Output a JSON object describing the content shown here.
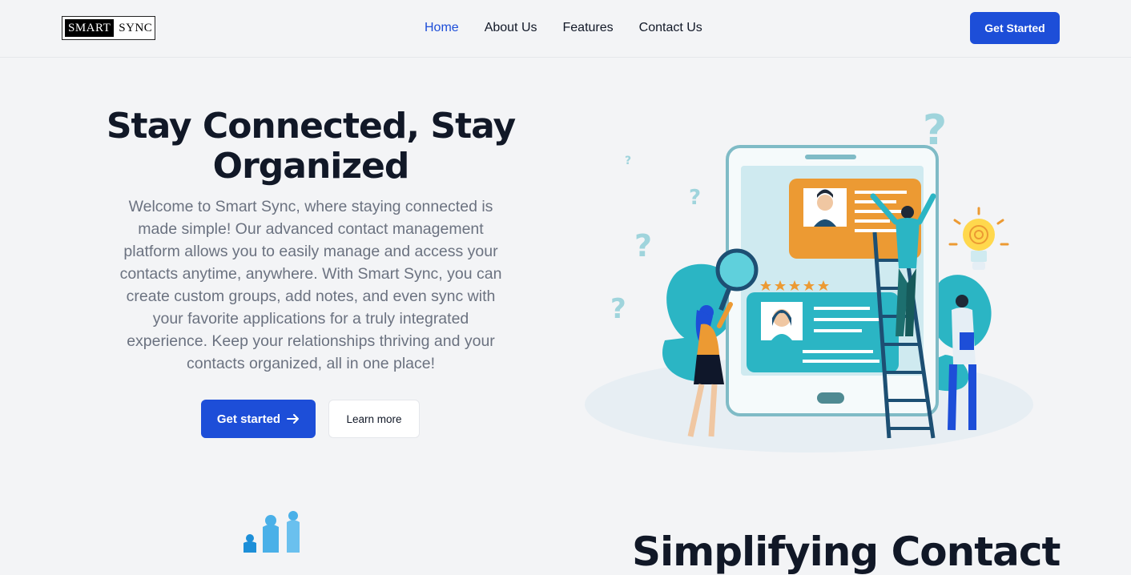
{
  "brand": {
    "logo_left": "SMART",
    "logo_right": "SYNC"
  },
  "nav": {
    "links": [
      {
        "label": "Home",
        "active": true
      },
      {
        "label": "About Us",
        "active": false
      },
      {
        "label": "Features",
        "active": false
      },
      {
        "label": "Contact Us",
        "active": false
      }
    ],
    "cta_label": "Get Started"
  },
  "hero": {
    "title": "Stay Connected, Stay Organized",
    "description": "Welcome to Smart Sync, where staying connected is made simple! Our advanced contact management platform allows you to easily manage and access your contacts anytime, anywhere. With Smart Sync, you can create custom groups, add notes, and even sync with your favorite applications for a truly integrated experience. Keep your relationships thriving and your contacts organized, all in one place!",
    "primary_button": "Get started",
    "secondary_button": "Learn more"
  },
  "section2": {
    "title": "Simplifying Contact"
  },
  "colors": {
    "primary": "#1d4ed8",
    "teal": "#2bb5c4",
    "orange": "#ec9a33",
    "background": "#f3f4f6"
  }
}
